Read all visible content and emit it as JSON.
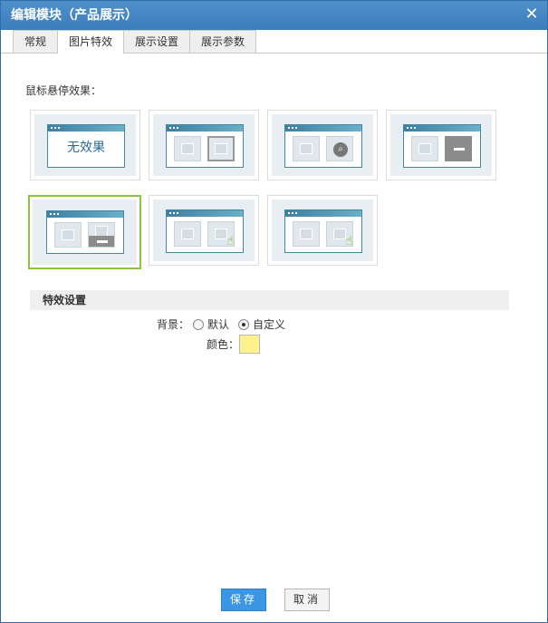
{
  "dialog": {
    "title": "编辑模块（产品展示）",
    "close_icon": "close-icon"
  },
  "tabs": [
    {
      "label": "常规",
      "active": false
    },
    {
      "label": "图片特效",
      "active": true
    },
    {
      "label": "展示设置",
      "active": false
    },
    {
      "label": "展示参数",
      "active": false
    }
  ],
  "hover": {
    "label": "鼠标悬停效果：",
    "options": [
      {
        "id": "none",
        "text": "无效果",
        "selected": false
      },
      {
        "id": "border",
        "selected": false
      },
      {
        "id": "zoom",
        "selected": false
      },
      {
        "id": "overlay",
        "selected": false
      },
      {
        "id": "caption-bar",
        "selected": true
      },
      {
        "id": "hand-pointer",
        "selected": false
      },
      {
        "id": "hand-pointer-alt",
        "selected": false
      }
    ]
  },
  "effects_settings": {
    "heading": "特效设置",
    "background_label": "背景：",
    "bg_default": "默认",
    "bg_custom": "自定义",
    "bg_selected": "custom",
    "color_label": "颜色：",
    "color_value": "#fff28c"
  },
  "footer": {
    "save_label": "保存",
    "cancel_label": "取消"
  }
}
